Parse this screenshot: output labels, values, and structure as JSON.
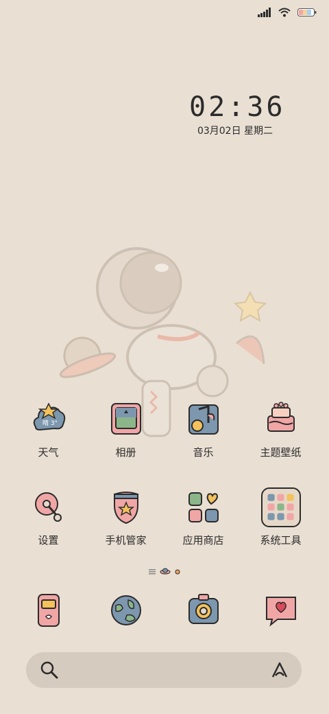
{
  "status_bar": {
    "signal_icon": "signal-bars-icon",
    "wifi_icon": "wifi-icon",
    "battery_icon": "battery-icon"
  },
  "clock": {
    "time": "02:36",
    "date": "03月02日 星期二"
  },
  "apps": [
    {
      "label": "天气",
      "icon": "weather-icon",
      "badge_text": "晴 3°"
    },
    {
      "label": "相册",
      "icon": "gallery-icon"
    },
    {
      "label": "音乐",
      "icon": "music-icon"
    },
    {
      "label": "主题壁纸",
      "icon": "themes-icon"
    },
    {
      "label": "设置",
      "icon": "settings-icon"
    },
    {
      "label": "手机管家",
      "icon": "security-icon"
    },
    {
      "label": "应用商店",
      "icon": "app-store-icon"
    },
    {
      "label": "系统工具",
      "icon": "folder-icon"
    }
  ],
  "dock": [
    {
      "icon": "phone-icon"
    },
    {
      "icon": "browser-icon"
    },
    {
      "icon": "camera-icon"
    },
    {
      "icon": "messages-icon"
    }
  ],
  "search": {
    "placeholder": "",
    "search_icon": "search-icon",
    "assistant_icon": "assistant-icon"
  },
  "pager": {
    "current_page_index": 1,
    "page_count": 2
  },
  "colors": {
    "background": "#e9dfd3",
    "search_bar": "#d6cbbf",
    "icon_pink": "#f1a6a6",
    "icon_blue": "#7c97ae",
    "icon_green": "#8db58a",
    "icon_yellow": "#f3c25d"
  }
}
